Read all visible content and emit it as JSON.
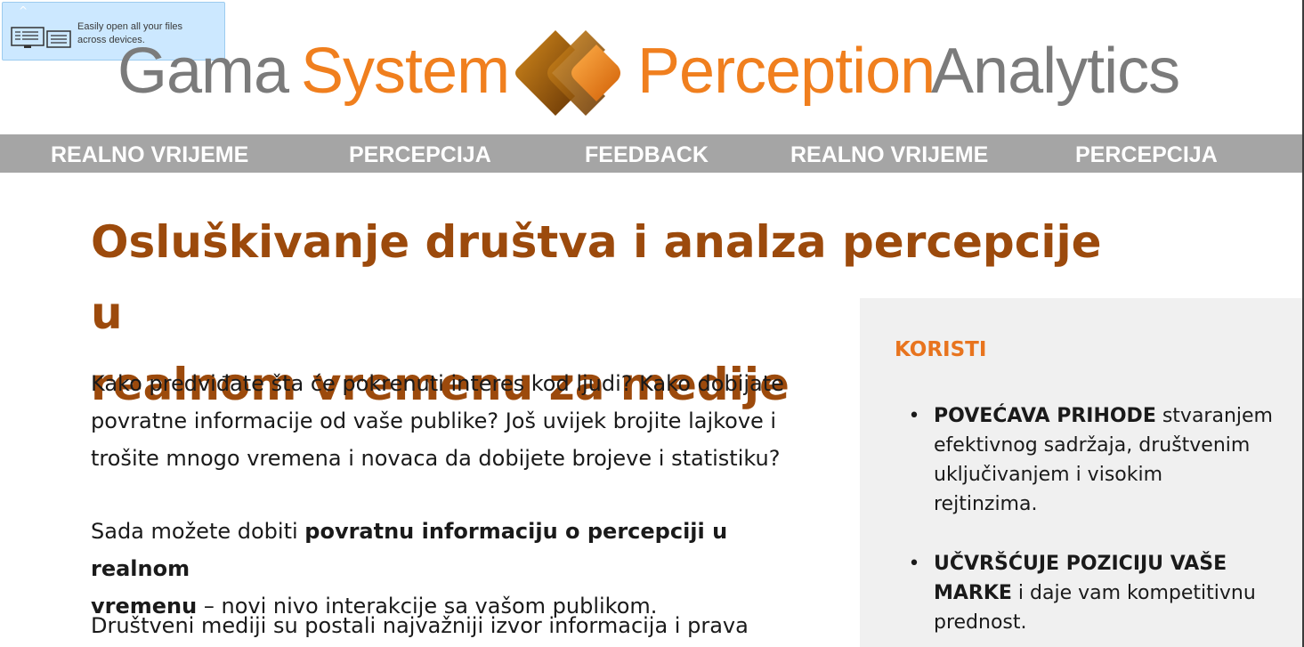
{
  "notification": {
    "line1": "Easily open all your files",
    "line2": "across devices.",
    "icon": "devices-icon",
    "caret": "^"
  },
  "logo": {
    "word1": "Gama",
    "word2": "System",
    "word3": "Perception",
    "word4": "Analytics",
    "colors": {
      "grey": "#7b7b7b",
      "orange": "#f07f1e"
    }
  },
  "nav": {
    "items": [
      "REALNO VRIJEME",
      "PERCEPCIJA",
      "FEEDBACK",
      "REALNO VRIJEME",
      "PERCEPCIJA"
    ],
    "background": "#a5a5a5"
  },
  "main": {
    "headline_line1": "Osluškivanje društva i analza percepcije u",
    "headline_line2": "realnom vremenu za medije",
    "p1_line1": "Kako predviđate šta će pokrenuti interes kod ljudi? Kako dobijate",
    "p1_line2": "povratne informacije od vaše publike? Još uvijek brojite lajkove i",
    "p1_line3": "trošite mnogo vremena i novaca da dobijete brojeve i statistiku?",
    "p2_pre": "Sada možete dobiti ",
    "p2_bold_line1": "povratnu informaciju o percepciji u realnom",
    "p2_bold_line2": "vremenu",
    "p2_post": " – novi nivo interakcije sa vašom publikom.",
    "p3_line1": "Društveni mediji su postali najvažniji izvor informacija i prava"
  },
  "sidebar": {
    "title": "KORISTI",
    "bullet": "•",
    "benefit1_bold": "POVEĆAVA PRIHODE",
    "benefit1_rest_a": " stvaranjem",
    "benefit1_rest_b": "efektivnog sadržaja, društvenim",
    "benefit1_rest_c": "uključivanjem i visokim",
    "benefit1_rest_d": "rejtinzima.",
    "benefit2_bold_a": "UČVRŠĆUJE POZICIJU VAŠE",
    "benefit2_bold_b": "MARKE",
    "benefit2_rest_a": " i daje vam kompetitivnu",
    "benefit2_rest_b": "prednost."
  },
  "colors": {
    "headline": "#9c4a0c",
    "accent": "#e8741e",
    "panel": "#f0f0f0",
    "toast": "#cce8ff"
  }
}
